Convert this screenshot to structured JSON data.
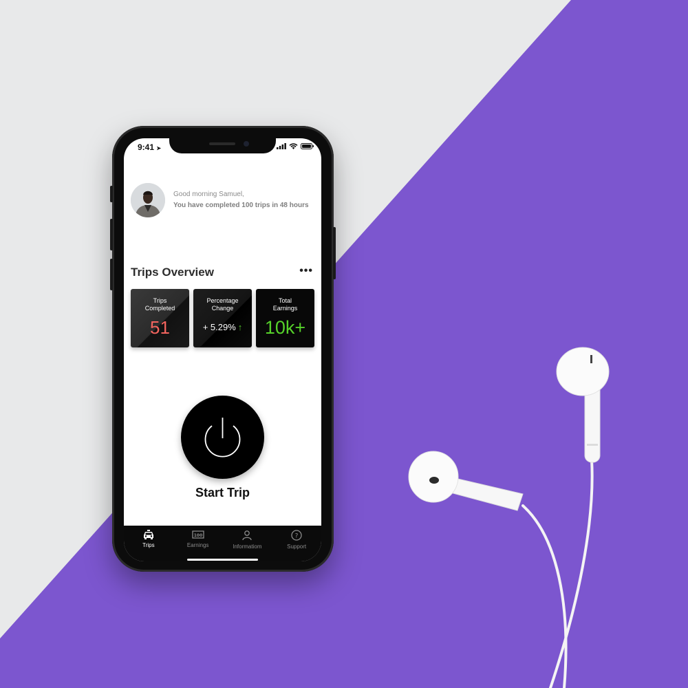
{
  "status_bar": {
    "time": "9:41"
  },
  "greeting": {
    "line1": "Good morning Samuel,",
    "line2": "You have completed 100 trips in 48 hours"
  },
  "overview": {
    "title": "Trips Overview",
    "more_label": "•••",
    "cards": [
      {
        "label": "Trips Completed",
        "value": "51",
        "color": "#f2645e"
      },
      {
        "label": "Percentage Change",
        "value": "+ 5.29%",
        "trend": "up",
        "trend_color": "#52c02d"
      },
      {
        "label": "Total Earnings",
        "value": "10k+",
        "color": "#56d22a"
      }
    ]
  },
  "action": {
    "label": "Start Trip",
    "icon": "power-icon"
  },
  "tabs": [
    {
      "label": "Trips",
      "icon": "car-icon",
      "active": true
    },
    {
      "label": "Earnings",
      "icon": "cash-icon",
      "active": false
    },
    {
      "label": "Informatiom",
      "icon": "person-icon",
      "active": false
    },
    {
      "label": "Support",
      "icon": "help-icon",
      "active": false
    }
  ],
  "colors": {
    "background_purple": "#7c56cf",
    "background_light": "#e8e9ea"
  }
}
